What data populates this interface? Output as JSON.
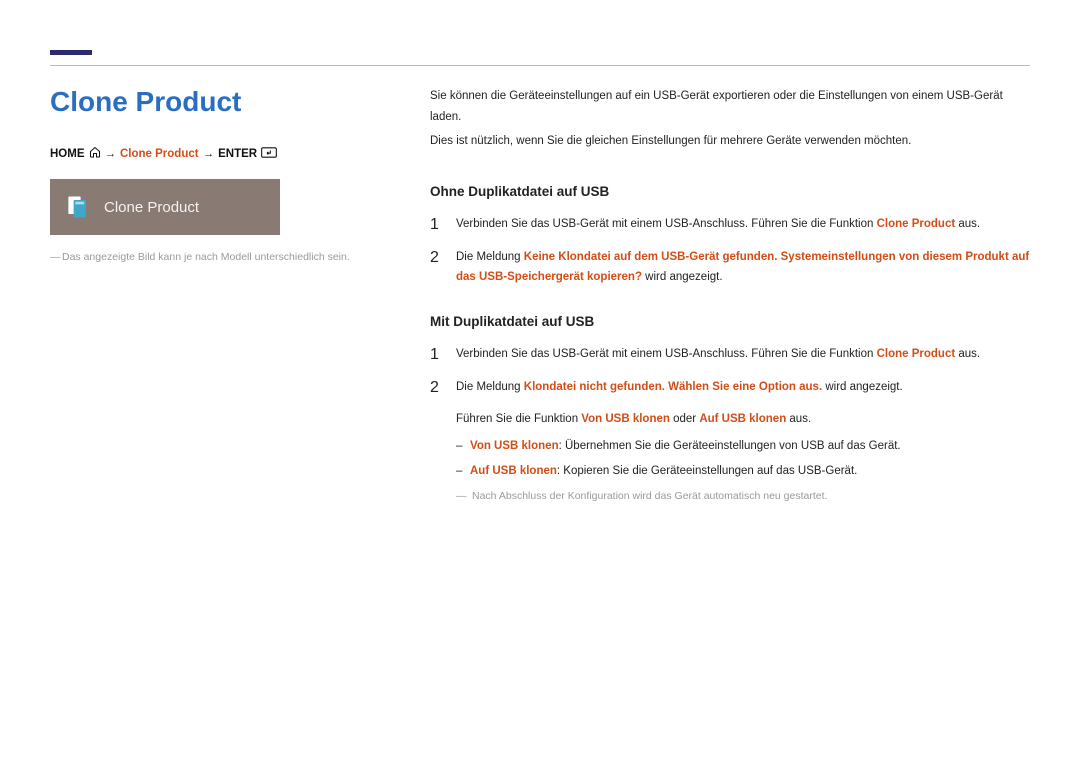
{
  "title": "Clone Product",
  "breadcrumb": {
    "home": "HOME",
    "arrow": "→",
    "clone": "Clone Product",
    "enter": "ENTER"
  },
  "tile": {
    "label": "Clone Product"
  },
  "left_note": "Das angezeigte Bild kann je nach Modell unterschiedlich sein.",
  "intro": {
    "p1": "Sie können die Geräteeinstellungen auf ein USB-Gerät exportieren oder die Einstellungen von einem USB-Gerät laden.",
    "p2": "Dies ist nützlich, wenn Sie die gleichen Einstellungen für mehrere Geräte verwenden möchten."
  },
  "sec1": {
    "heading": "Ohne Duplikatdatei auf USB",
    "step1_a": "Verbinden Sie das USB-Gerät mit einem USB-Anschluss. Führen Sie die Funktion ",
    "step1_hl": "Clone Product",
    "step1_b": " aus.",
    "step2_a": "Die Meldung ",
    "step2_hl": "Keine Klondatei auf dem USB-Gerät gefunden. Systemeinstellungen von diesem Produkt auf das USB-Speichergerät kopieren?",
    "step2_b": " wird angezeigt."
  },
  "sec2": {
    "heading": "Mit Duplikatdatei auf USB",
    "step1_a": "Verbinden Sie das USB-Gerät mit einem USB-Anschluss. Führen Sie die Funktion ",
    "step1_hl": "Clone Product",
    "step1_b": " aus.",
    "step2_a": "Die Meldung ",
    "step2_hl": "Klondatei nicht gefunden. Wählen Sie eine Option aus.",
    "step2_b": " wird angezeigt.",
    "sub_a": "Führen Sie die Funktion ",
    "sub_hl1": "Von USB klonen",
    "sub_mid": " oder ",
    "sub_hl2": "Auf USB klonen",
    "sub_b": " aus.",
    "d1_label": "Von USB klonen",
    "d1_text": ": Übernehmen Sie die Geräteeinstellungen von USB auf das Gerät.",
    "d2_label": "Auf USB klonen",
    "d2_text": ": Kopieren Sie die Geräteeinstellungen auf das USB-Gerät.",
    "footnote": "Nach Abschluss der Konfiguration wird das Gerät automatisch neu gestartet."
  }
}
